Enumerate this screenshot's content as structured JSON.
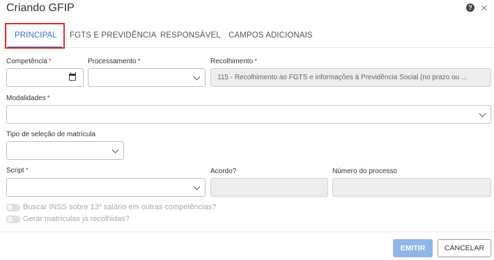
{
  "dialog": {
    "title": "Criando GFIP",
    "help_icon": "?",
    "close_icon": "×"
  },
  "tabs": [
    {
      "label": "PRINCIPAL",
      "active": true
    },
    {
      "label": "FGTS E PREVIDÊNCIA",
      "active": false
    },
    {
      "label": "RESPONSÁVEL",
      "active": false
    },
    {
      "label": "CAMPOS ADICIONAIS",
      "active": false
    }
  ],
  "form": {
    "competencia": {
      "label": "Competência",
      "value": ""
    },
    "processamento": {
      "label": "Processamento",
      "value": ""
    },
    "recolhimento": {
      "label": "Recolhimento",
      "value": "115 - Recolhimento ao FGTS e informações à Previdência Social (no prazo ou ..."
    },
    "modalidades": {
      "label": "Modalidades",
      "value": ""
    },
    "tipo_selecao": {
      "label": "Tipo de seleção de matrícula",
      "value": ""
    },
    "script": {
      "label": "Script",
      "value": ""
    },
    "acordo": {
      "label": "Acordo?",
      "value": ""
    },
    "numero_processo": {
      "label": "Número do processo",
      "value": ""
    },
    "required_mark": "*"
  },
  "toggles": [
    {
      "label": "Buscar INSS sobre 13º salário em outras competências?",
      "on": false
    },
    {
      "label": "Gerar matrículas já recolhidas?",
      "on": false
    }
  ],
  "footer": {
    "emitir_label": "EMITIR",
    "cancelar_label": "CANCELAR"
  },
  "colors": {
    "accent": "#2f74c0",
    "highlight": "#e02a2a",
    "required": "#d9322d",
    "primary_disabled": "#8fb6e6"
  }
}
